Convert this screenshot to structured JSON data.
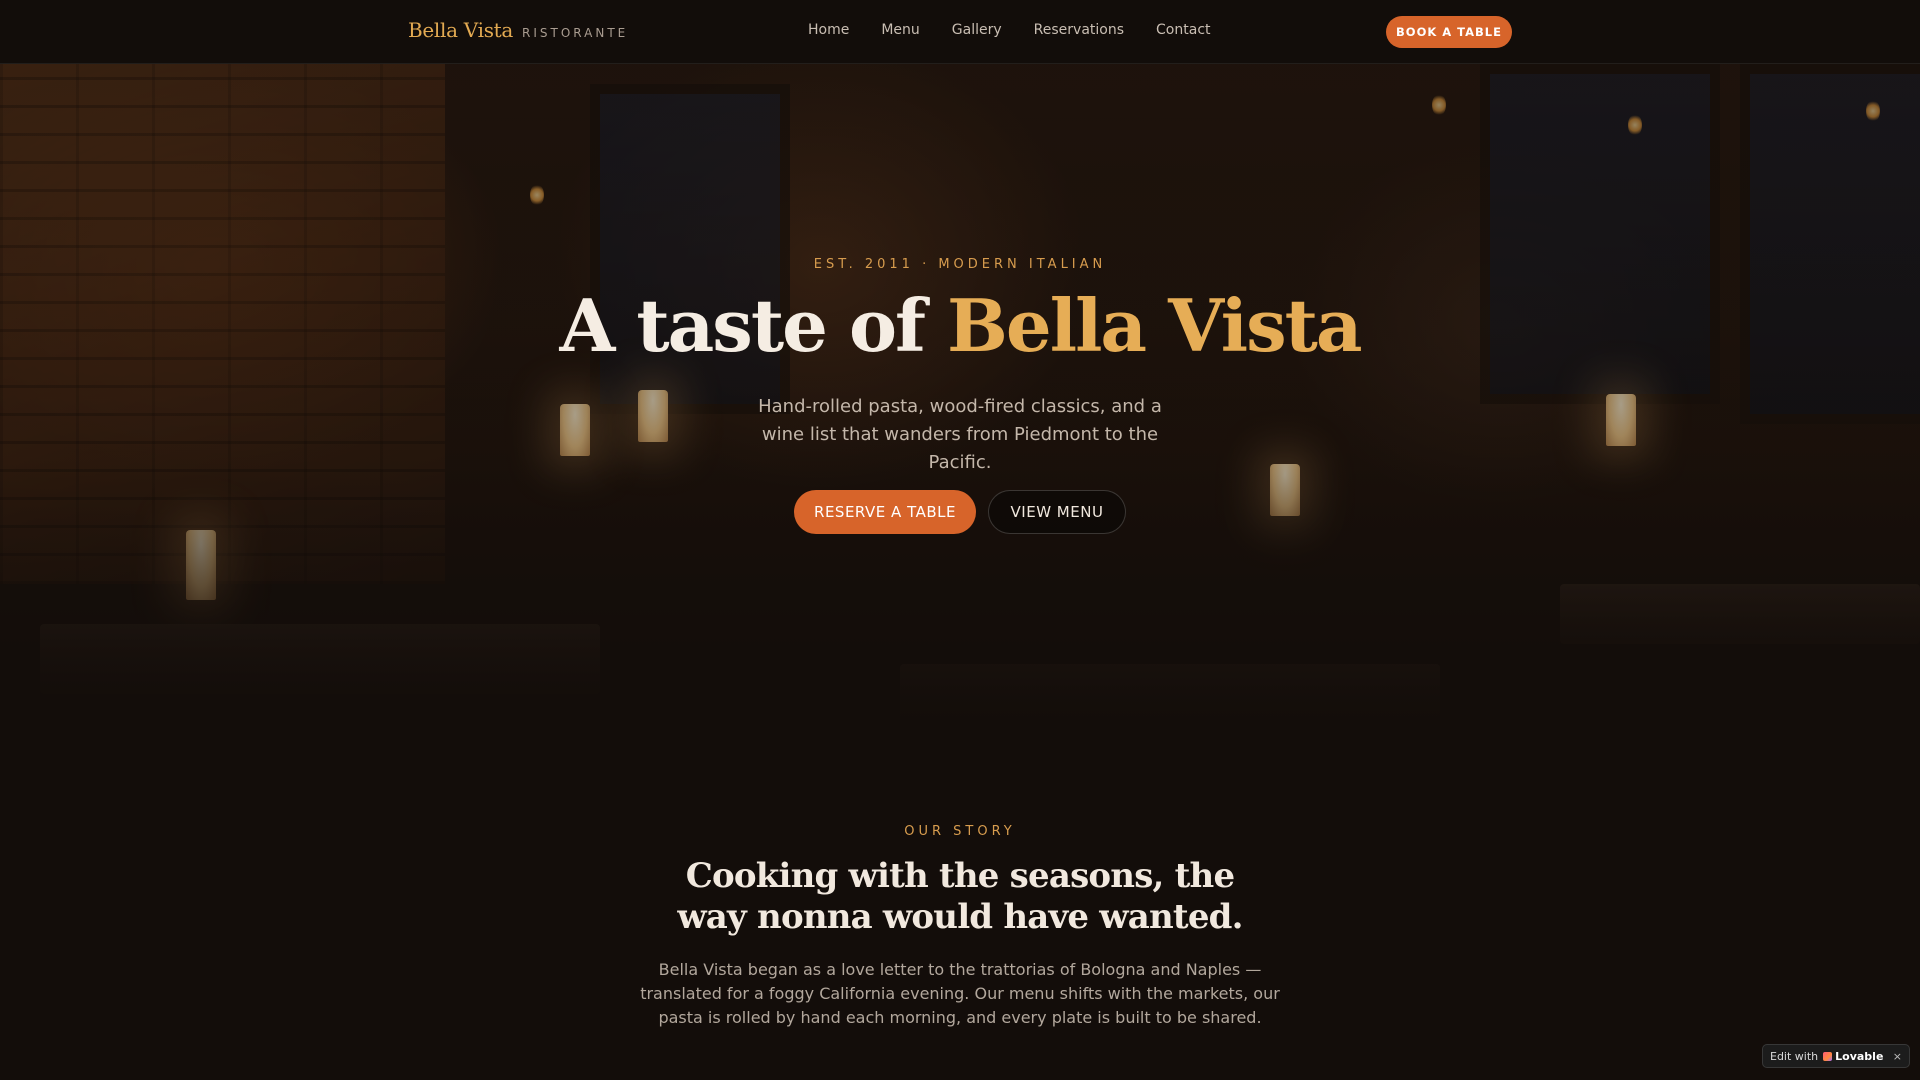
{
  "nav": {
    "brand_name": "Bella Vista",
    "brand_sub": "RISTORANTE",
    "links": [
      "Home",
      "Menu",
      "Gallery",
      "Reservations",
      "Contact"
    ],
    "cta_label": "BOOK A TABLE"
  },
  "hero": {
    "eyebrow": "EST. 2011 · MODERN ITALIAN",
    "title_plain": "A taste of ",
    "title_accent": "Bella Vista",
    "subtitle": "Hand-rolled pasta, wood-fired classics, and a wine list that wanders from Piedmont to the Pacific.",
    "primary_button": "RESERVE A TABLE",
    "secondary_button": "VIEW MENU"
  },
  "story": {
    "eyebrow": "OUR STORY",
    "title": "Cooking with the seasons, the way nonna would have wanted.",
    "body": "Bella Vista began as a love letter to the trattorias of Bologna and Naples — translated for a foggy California evening. Our menu shifts with the markets, our pasta is rolled by hand each morning, and every plate is built to be shared."
  },
  "badge": {
    "edit_label": "Edit with",
    "brand": "Lovable",
    "close": "×"
  },
  "colors": {
    "accent": "#d7642a",
    "gold": "#e6ad56",
    "background": "#130d0a"
  }
}
